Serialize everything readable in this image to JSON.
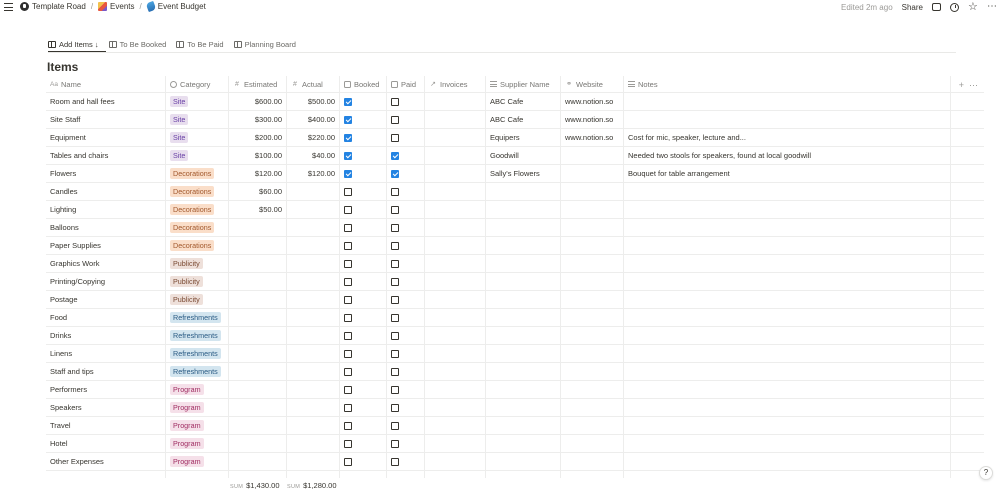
{
  "colors": {
    "checkbox_on": "#2383e2",
    "text": "#37352f",
    "muted": "#9b9a97"
  },
  "tag_colors": {
    "Site": {
      "bg": "#e8deee",
      "fg": "#6940a5"
    },
    "Decorations": {
      "bg": "#fadec9",
      "fg": "#a2582c"
    },
    "Publicity": {
      "bg": "#eee0da",
      "fg": "#7a4a33"
    },
    "Refreshments": {
      "bg": "#d3e5ef",
      "fg": "#2a5b84"
    },
    "Program": {
      "bg": "#f5e0e9",
      "fg": "#a02d62"
    }
  },
  "breadcrumb": [
    {
      "label": "Template Road",
      "icon": "workspace-icon"
    },
    {
      "label": "Events",
      "icon": "events-icon"
    },
    {
      "label": "Event Budget",
      "icon": "event-budget-icon"
    }
  ],
  "topbar": {
    "edited": "Edited 2m ago",
    "share": "Share"
  },
  "tabs": [
    {
      "label": "Add Items ↓",
      "active": true
    },
    {
      "label": "To Be Booked",
      "active": false
    },
    {
      "label": "To Be Paid",
      "active": false
    },
    {
      "label": "Planning Board",
      "active": false
    }
  ],
  "page_title": "Items",
  "columns": [
    "Name",
    "Category",
    "Estimated",
    "Actual",
    "Booked",
    "Paid",
    "Invoices",
    "Supplier Name",
    "Website",
    "Notes"
  ],
  "rows": [
    {
      "name": "Room and hall fees",
      "category": "Site",
      "estimated": "$600.00",
      "actual": "$500.00",
      "booked": true,
      "paid": false,
      "supplier": "ABC Cafe",
      "website": "www.notion.so",
      "notes": ""
    },
    {
      "name": "Site Staff",
      "category": "Site",
      "estimated": "$300.00",
      "actual": "$400.00",
      "booked": true,
      "paid": false,
      "supplier": "ABC Cafe",
      "website": "www.notion.so",
      "notes": ""
    },
    {
      "name": "Equipment",
      "category": "Site",
      "estimated": "$200.00",
      "actual": "$220.00",
      "booked": true,
      "paid": false,
      "supplier": "Equipers",
      "website": "www.notion.so",
      "notes": "Cost for mic, speaker, lecture and..."
    },
    {
      "name": "Tables and chairs",
      "category": "Site",
      "estimated": "$100.00",
      "actual": "$40.00",
      "booked": true,
      "paid": true,
      "supplier": "Goodwill",
      "website": "",
      "notes": "Needed two stools for speakers, found at local goodwill"
    },
    {
      "name": "Flowers",
      "category": "Decorations",
      "estimated": "$120.00",
      "actual": "$120.00",
      "booked": true,
      "paid": true,
      "supplier": "Sally's Flowers",
      "website": "",
      "notes": "Bouquet for table arrangement"
    },
    {
      "name": "Candles",
      "category": "Decorations",
      "estimated": "$60.00",
      "actual": "",
      "booked": false,
      "paid": false,
      "supplier": "",
      "website": "",
      "notes": ""
    },
    {
      "name": "Lighting",
      "category": "Decorations",
      "estimated": "$50.00",
      "actual": "",
      "booked": false,
      "paid": false,
      "supplier": "",
      "website": "",
      "notes": ""
    },
    {
      "name": "Balloons",
      "category": "Decorations",
      "estimated": "",
      "actual": "",
      "booked": false,
      "paid": false,
      "supplier": "",
      "website": "",
      "notes": ""
    },
    {
      "name": "Paper Supplies",
      "category": "Decorations",
      "estimated": "",
      "actual": "",
      "booked": false,
      "paid": false,
      "supplier": "",
      "website": "",
      "notes": ""
    },
    {
      "name": "Graphics Work",
      "category": "Publicity",
      "estimated": "",
      "actual": "",
      "booked": false,
      "paid": false,
      "supplier": "",
      "website": "",
      "notes": ""
    },
    {
      "name": "Printing/Copying",
      "category": "Publicity",
      "estimated": "",
      "actual": "",
      "booked": false,
      "paid": false,
      "supplier": "",
      "website": "",
      "notes": ""
    },
    {
      "name": "Postage",
      "category": "Publicity",
      "estimated": "",
      "actual": "",
      "booked": false,
      "paid": false,
      "supplier": "",
      "website": "",
      "notes": ""
    },
    {
      "name": "Food",
      "category": "Refreshments",
      "estimated": "",
      "actual": "",
      "booked": false,
      "paid": false,
      "supplier": "",
      "website": "",
      "notes": ""
    },
    {
      "name": "Drinks",
      "category": "Refreshments",
      "estimated": "",
      "actual": "",
      "booked": false,
      "paid": false,
      "supplier": "",
      "website": "",
      "notes": ""
    },
    {
      "name": "Linens",
      "category": "Refreshments",
      "estimated": "",
      "actual": "",
      "booked": false,
      "paid": false,
      "supplier": "",
      "website": "",
      "notes": ""
    },
    {
      "name": "Staff and tips",
      "category": "Refreshments",
      "estimated": "",
      "actual": "",
      "booked": false,
      "paid": false,
      "supplier": "",
      "website": "",
      "notes": ""
    },
    {
      "name": "Performers",
      "category": "Program",
      "estimated": "",
      "actual": "",
      "booked": false,
      "paid": false,
      "supplier": "",
      "website": "",
      "notes": ""
    },
    {
      "name": "Speakers",
      "category": "Program",
      "estimated": "",
      "actual": "",
      "booked": false,
      "paid": false,
      "supplier": "",
      "website": "",
      "notes": ""
    },
    {
      "name": "Travel",
      "category": "Program",
      "estimated": "",
      "actual": "",
      "booked": false,
      "paid": false,
      "supplier": "",
      "website": "",
      "notes": ""
    },
    {
      "name": "Hotel",
      "category": "Program",
      "estimated": "",
      "actual": "",
      "booked": false,
      "paid": false,
      "supplier": "",
      "website": "",
      "notes": ""
    },
    {
      "name": "Other Expenses",
      "category": "Program",
      "estimated": "",
      "actual": "",
      "booked": false,
      "paid": false,
      "supplier": "",
      "website": "",
      "notes": ""
    },
    {
      "name": "",
      "category": "",
      "estimated": "",
      "actual": "",
      "booked": false,
      "paid": false,
      "supplier": "",
      "website": "",
      "notes": ""
    }
  ],
  "footer": {
    "estimated_label": "SUM",
    "estimated_sum": "$1,430.00",
    "actual_label": "SUM",
    "actual_sum": "$1,280.00"
  },
  "help": "?"
}
